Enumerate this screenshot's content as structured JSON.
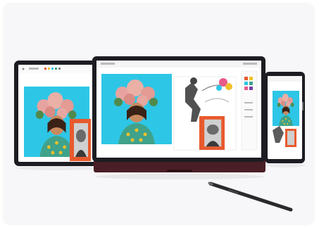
{
  "scene": {
    "colors": {
      "card_bg": "#f7f6f8",
      "device_frame": "#1c1c22",
      "screen_bg": "#ffffff",
      "art_cyan": "#2ec6e6",
      "art_orange": "#e85a2e",
      "flower_pink": "#e8a3a0",
      "dress_green": "#3fa28a",
      "dot_yellow": "#f1c12c",
      "hinge_burgundy": "#4a1e26",
      "pen": "#2a2a2e"
    },
    "icons": {
      "tablet": "tablet-icon",
      "laptop": "laptop-icon",
      "phone": "phone-icon",
      "pen": "stylus-icon"
    }
  }
}
